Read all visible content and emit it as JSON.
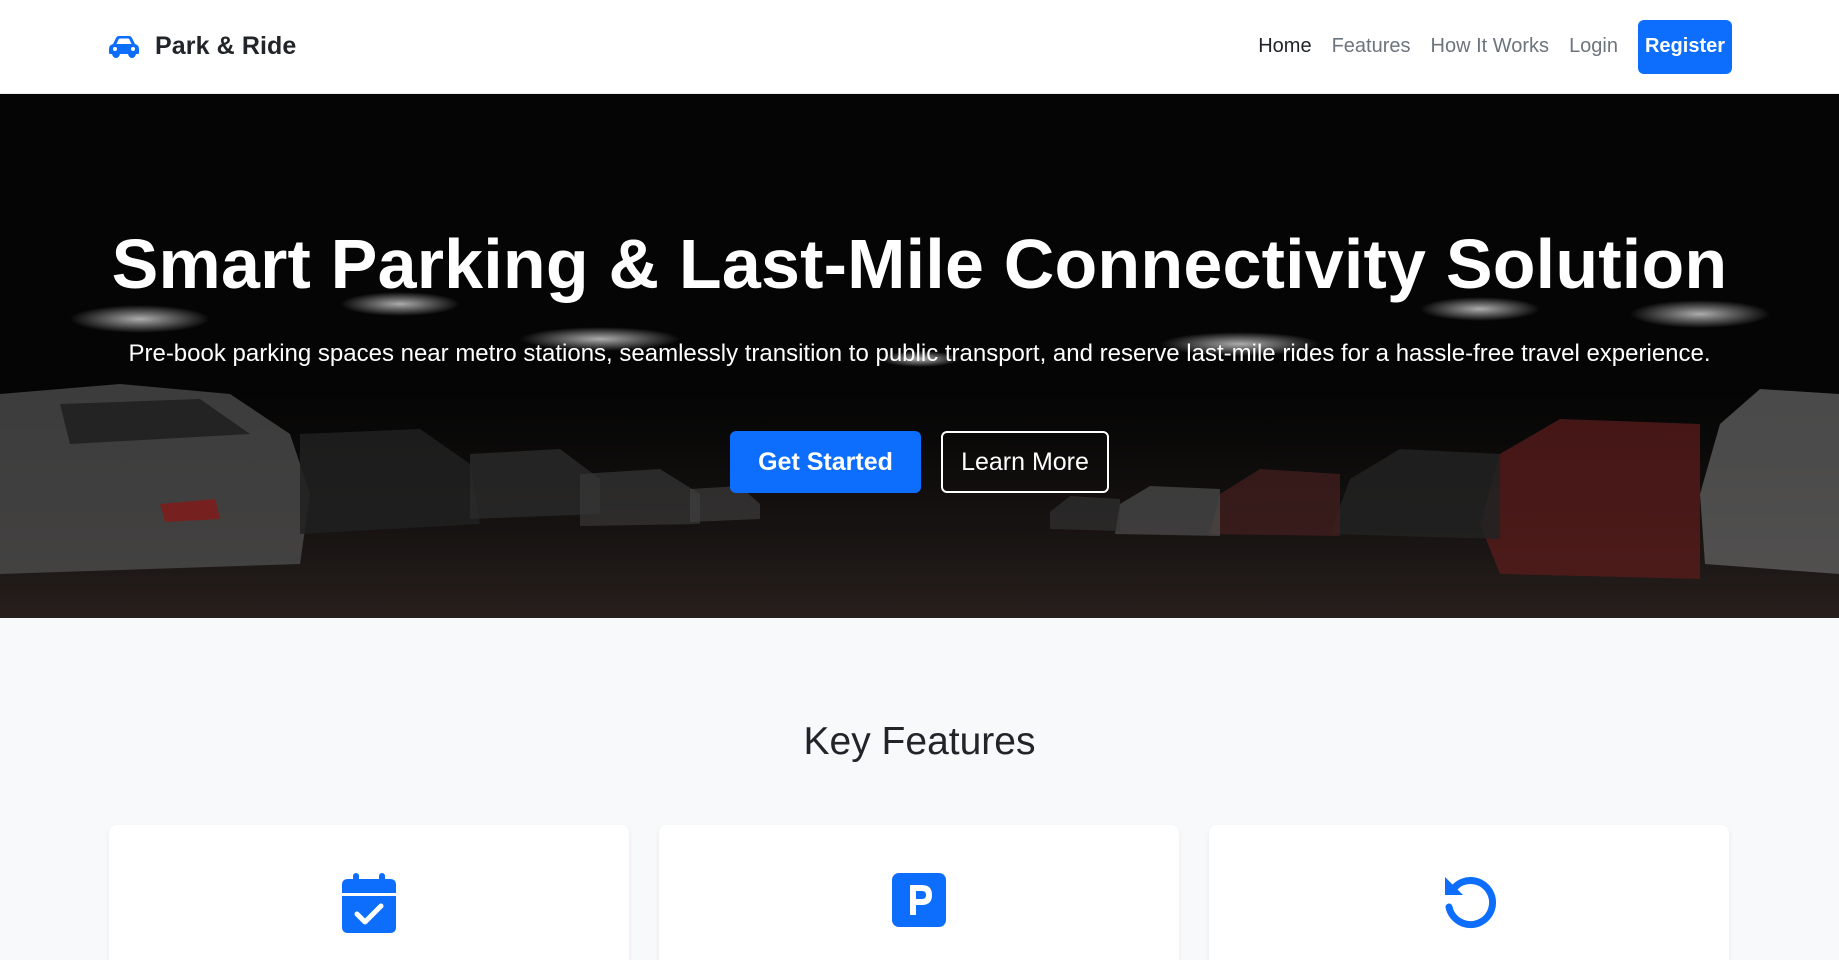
{
  "brand": {
    "name": "Park & Ride",
    "icon": "car-icon"
  },
  "nav": {
    "items": [
      {
        "label": "Home",
        "active": true
      },
      {
        "label": "Features",
        "active": false
      },
      {
        "label": "How It Works",
        "active": false
      },
      {
        "label": "Login",
        "active": false
      }
    ],
    "register_label": "Register"
  },
  "hero": {
    "title": "Smart Parking & Last-Mile Connectivity Solution",
    "subtitle": "Pre-book parking spaces near metro stations, seamlessly transition to public transport, and reserve last-mile rides for a hassle-free travel experience.",
    "primary_button": "Get Started",
    "secondary_button": "Learn More",
    "background": "parking-garage-photo"
  },
  "features": {
    "title": "Key Features",
    "cards": [
      {
        "icon": "calendar-check-icon"
      },
      {
        "icon": "parking-icon"
      },
      {
        "icon": "rotate-left-icon"
      }
    ]
  },
  "colors": {
    "accent": "#0d6efd",
    "nav_text": "#6c757d",
    "nav_active": "#212529",
    "section_bg": "#f8f9fa"
  }
}
